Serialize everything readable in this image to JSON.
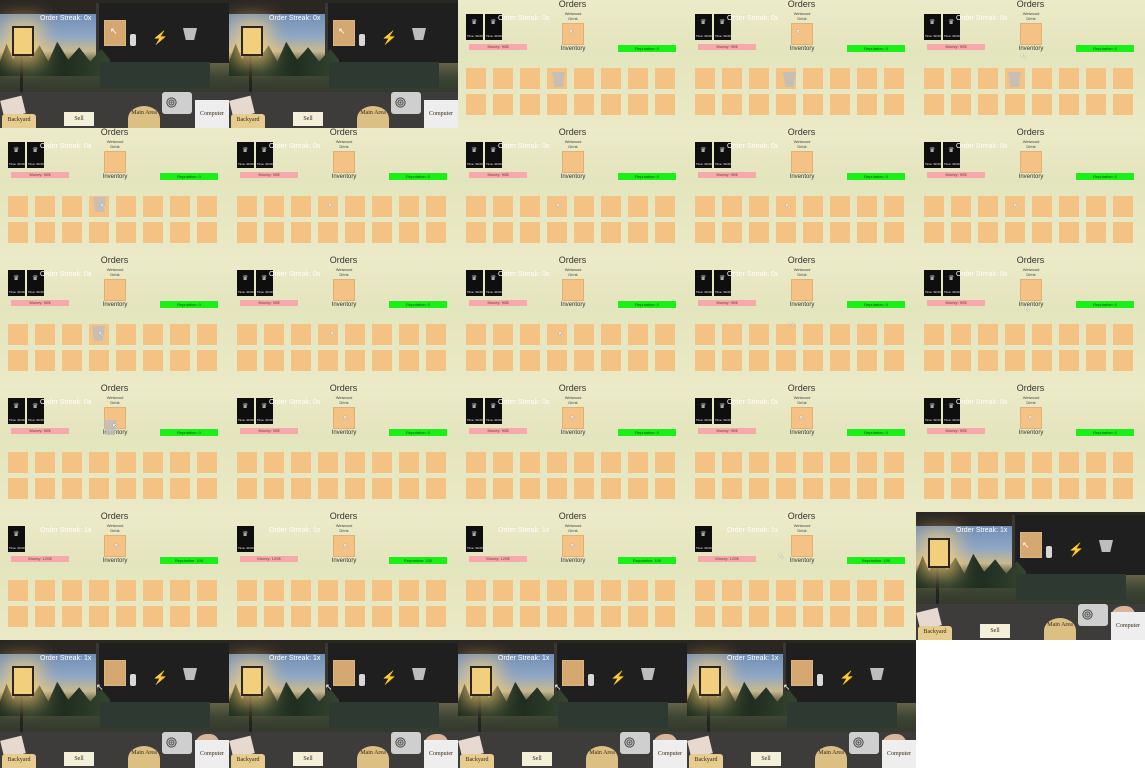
{
  "game": {
    "orders_title": "Orders",
    "inventory_label": "Inventory",
    "drink_label_line1": "Wetwood",
    "drink_label_line2": "Drink",
    "streak_0": "Order Streak: 0x",
    "streak_1": "Order Streak: 1x",
    "money_before": "Money: 90$",
    "money_after": "Money: 120$",
    "reputation_before": "Reputation: 0",
    "reputation_after": "Reputation: 100",
    "order_time": "Time: 30.00",
    "buttons": {
      "backyard": "Backyard",
      "sell": "Sell",
      "main_area": "Main Area",
      "computer": "Computer"
    },
    "cursor_glyph": "↖",
    "bolt_glyph": "⚡",
    "drink_glyph": "♛"
  },
  "icons": [
    "lightning-bolt-icon",
    "cup-icon",
    "drink-icon",
    "cursor-icon",
    "radio-icon"
  ]
}
